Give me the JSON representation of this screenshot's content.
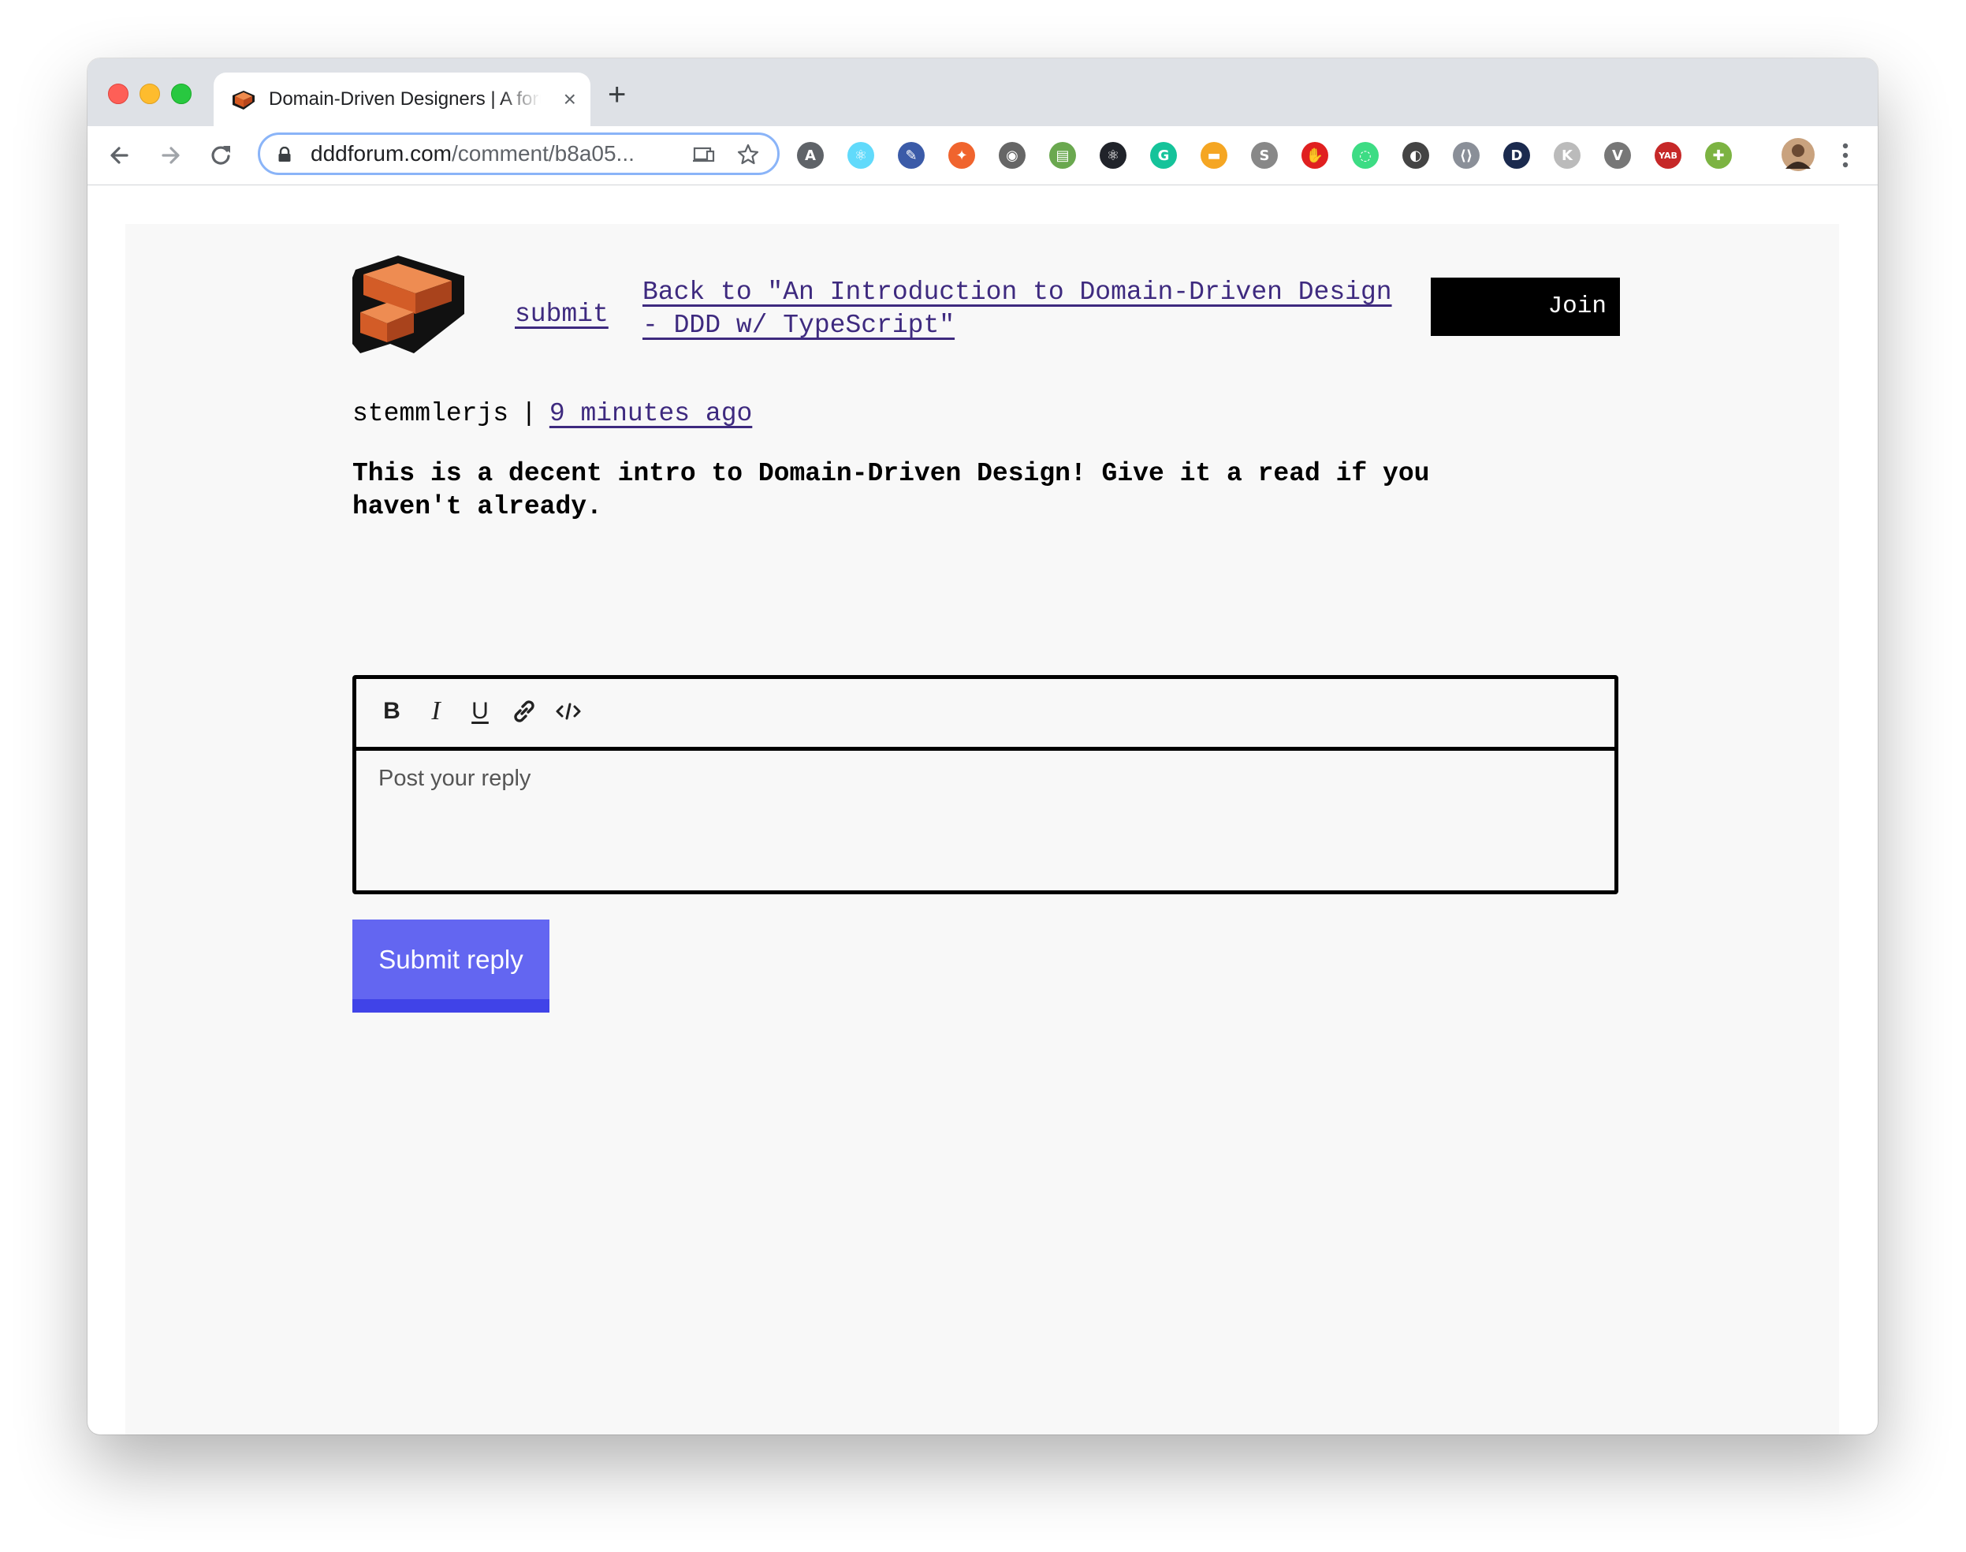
{
  "browser": {
    "tab_title": "Domain-Driven Designers | A forum",
    "tab_close": "×",
    "new_tab": "+",
    "url_host": "dddforum.com",
    "url_path": "/comment/b8a05...",
    "extensions": [
      {
        "name": "angular-extension-icon",
        "glyph": "A",
        "color": "#5f6368"
      },
      {
        "name": "react-devtools-icon",
        "glyph": "⚛",
        "color": "#61dafb"
      },
      {
        "name": "color-picker-icon",
        "glyph": "✎",
        "color": "#3b5ba8"
      },
      {
        "name": "ublock-icon",
        "glyph": "✦",
        "color": "#f0642e"
      },
      {
        "name": "video-extension-icon",
        "glyph": "◉",
        "color": "#666666"
      },
      {
        "name": "print-extension-icon",
        "glyph": "▤",
        "color": "#6aa84f"
      },
      {
        "name": "react-extension-icon",
        "glyph": "⚛",
        "color": "#20232a"
      },
      {
        "name": "grammarly-icon",
        "glyph": "G",
        "color": "#15c39a"
      },
      {
        "name": "analytics-extension-icon",
        "glyph": "▬",
        "color": "#f5a623"
      },
      {
        "name": "s-extension-icon",
        "glyph": "S",
        "color": "#888888"
      },
      {
        "name": "adblock-icon",
        "glyph": "✋",
        "color": "#e02020"
      },
      {
        "name": "loading-extension-icon",
        "glyph": "◌",
        "color": "#3ddc84"
      },
      {
        "name": "dark-mode-icon",
        "glyph": "◐",
        "color": "#444444"
      },
      {
        "name": "code-extension-icon",
        "glyph": "⟨⟩",
        "color": "#8a8f98"
      },
      {
        "name": "dx-extension-icon",
        "glyph": "D",
        "color": "#1b2a4e"
      },
      {
        "name": "k-extension-icon",
        "glyph": "K",
        "color": "#bbbbbb"
      },
      {
        "name": "vue-devtools-icon",
        "glyph": "V",
        "color": "#777777"
      },
      {
        "name": "yab-extension-icon",
        "glyph": "YAB",
        "color": "#c62828"
      },
      {
        "name": "android-extension-icon",
        "glyph": "✚",
        "color": "#7cb342"
      }
    ]
  },
  "site": {
    "submit_label": "submit",
    "back_link": "Back to \"An Introduction to Domain-Driven Design - DDD w/ TypeScript\"",
    "join_label": "Join"
  },
  "comment": {
    "author": "stemmlerjs",
    "separator": "|",
    "time": "9 minutes ago",
    "text": "This is a decent intro to Domain-Driven Design! Give it a read if you haven't already."
  },
  "editor": {
    "bold": "B",
    "italic": "I",
    "underline": "U",
    "placeholder": "Post your reply"
  },
  "reply_button": "Submit reply",
  "colors": {
    "link": "#3e2a7f",
    "accent": "#6366f1",
    "accent_dark": "#4043e8",
    "page_bg": "#f8f8f8"
  }
}
